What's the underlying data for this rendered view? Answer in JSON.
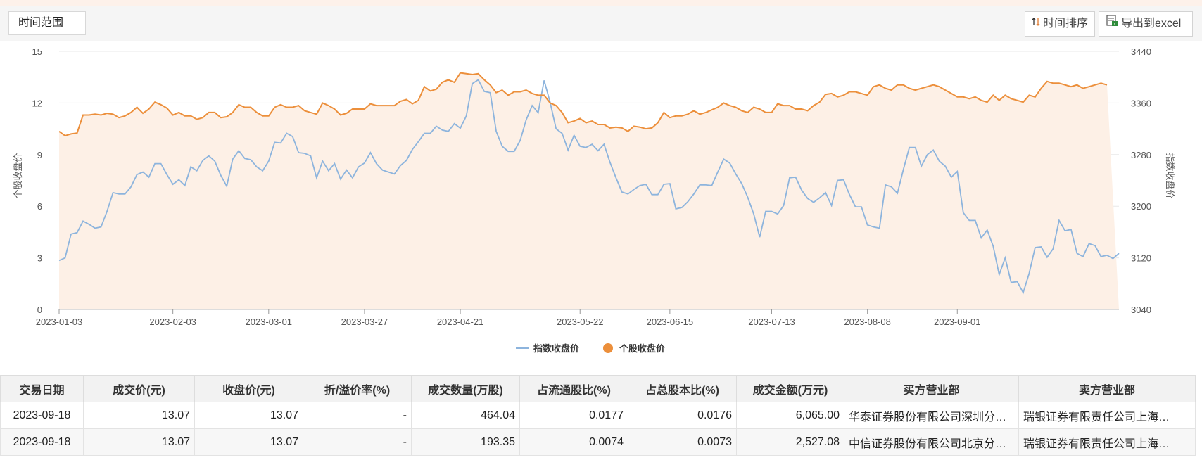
{
  "toolbar": {
    "range_label": "时间范围",
    "sort_label": "时间排序",
    "export_label": "导出到excel"
  },
  "colors": {
    "index_line": "#8db4dd",
    "stock_line": "#ec8f3b",
    "stock_fill": "#fdf0e6"
  },
  "chart_data": {
    "type": "line",
    "x_ticks": [
      "2023-01-03",
      "2023-02-03",
      "2023-03-01",
      "2023-03-27",
      "2023-04-21",
      "2023-05-22",
      "2023-06-15",
      "2023-07-13",
      "2023-08-08",
      "2023-09-01"
    ],
    "y_left": {
      "label": "个股收盘价",
      "min": 0,
      "max": 15,
      "ticks": [
        0,
        3,
        6,
        9,
        12,
        15
      ]
    },
    "y_right": {
      "label": "指数收盘价",
      "min": 3040,
      "max": 3440,
      "ticks": [
        3040,
        3120,
        3200,
        3280,
        3360,
        3440
      ]
    },
    "legend": [
      "指数收盘价",
      "个股收盘价"
    ],
    "series": [
      {
        "name": "指数收盘价",
        "axis": "right",
        "values": [
          3116,
          3120,
          3157,
          3159,
          3177,
          3172,
          3166,
          3168,
          3192,
          3221,
          3219,
          3219,
          3230,
          3249,
          3253,
          3245,
          3266,
          3266,
          3249,
          3234,
          3241,
          3232,
          3261,
          3255,
          3271,
          3278,
          3270,
          3248,
          3231,
          3273,
          3286,
          3274,
          3272,
          3261,
          3255,
          3270,
          3299,
          3298,
          3313,
          3308,
          3283,
          3282,
          3278,
          3244,
          3270,
          3255,
          3266,
          3242,
          3256,
          3244,
          3261,
          3267,
          3283,
          3266,
          3256,
          3253,
          3250,
          3263,
          3271,
          3288,
          3300,
          3313,
          3313,
          3324,
          3318,
          3316,
          3328,
          3321,
          3340,
          3390,
          3396,
          3378,
          3376,
          3316,
          3293,
          3285,
          3285,
          3302,
          3334,
          3356,
          3345,
          3395,
          3361,
          3320,
          3313,
          3287,
          3310,
          3293,
          3291,
          3296,
          3286,
          3296,
          3268,
          3244,
          3222,
          3219,
          3226,
          3232,
          3234,
          3218,
          3218,
          3234,
          3235,
          3196,
          3198,
          3207,
          3219,
          3233,
          3233,
          3232,
          3253,
          3273,
          3267,
          3250,
          3235,
          3214,
          3188,
          3152,
          3192,
          3192,
          3188,
          3201,
          3244,
          3245,
          3225,
          3212,
          3206,
          3213,
          3221,
          3201,
          3240,
          3241,
          3218,
          3199,
          3199,
          3171,
          3168,
          3166,
          3233,
          3230,
          3220,
          3257,
          3291,
          3291,
          3262,
          3280,
          3287,
          3270,
          3262,
          3245,
          3254,
          3190,
          3178,
          3178,
          3151,
          3163,
          3138,
          3094,
          3120,
          3082,
          3083,
          3066,
          3096,
          3136,
          3137,
          3121,
          3134,
          3178,
          3162,
          3164,
          3127,
          3122,
          3142,
          3139,
          3122,
          3124,
          3119,
          3127
        ]
      },
      {
        "name": "个股收盘价",
        "axis": "left",
        "values": [
          10.35,
          10.1,
          10.2,
          10.25,
          11.3,
          11.3,
          11.35,
          11.3,
          11.4,
          11.35,
          11.15,
          11.25,
          11.45,
          11.75,
          11.4,
          11.65,
          12.05,
          11.9,
          11.7,
          11.3,
          11.45,
          11.25,
          11.25,
          11.05,
          11.15,
          11.45,
          11.45,
          11.15,
          11.2,
          11.45,
          11.9,
          11.75,
          11.75,
          11.45,
          11.25,
          11.25,
          11.75,
          11.9,
          11.75,
          11.75,
          11.85,
          11.55,
          11.45,
          11.35,
          12.0,
          11.85,
          11.65,
          11.3,
          11.4,
          11.65,
          11.65,
          11.65,
          11.95,
          11.85,
          11.85,
          11.85,
          11.85,
          12.1,
          12.2,
          11.95,
          12.15,
          12.95,
          12.7,
          12.8,
          13.2,
          13.35,
          13.2,
          13.75,
          13.7,
          13.65,
          13.7,
          13.35,
          13.05,
          12.6,
          12.75,
          12.45,
          12.65,
          12.65,
          12.75,
          12.55,
          12.45,
          12.45,
          12.0,
          11.85,
          11.45,
          10.85,
          10.95,
          11.1,
          10.85,
          10.95,
          10.75,
          10.75,
          10.55,
          10.6,
          10.55,
          10.35,
          10.65,
          10.6,
          10.5,
          10.55,
          10.85,
          11.45,
          11.15,
          11.25,
          11.25,
          11.35,
          11.55,
          11.35,
          11.45,
          11.6,
          11.75,
          12.0,
          11.85,
          11.75,
          11.55,
          11.45,
          11.75,
          11.65,
          11.45,
          11.45,
          11.95,
          11.85,
          11.85,
          11.65,
          11.65,
          11.55,
          11.85,
          12.05,
          12.5,
          12.55,
          12.35,
          12.45,
          12.65,
          12.65,
          12.55,
          12.45,
          12.95,
          13.05,
          12.85,
          12.75,
          13.05,
          13.05,
          12.85,
          12.75,
          12.85,
          12.95,
          13.05,
          12.95,
          12.75,
          12.55,
          12.35,
          12.35,
          12.25,
          12.35,
          12.15,
          12.05,
          12.45,
          12.15,
          12.45,
          12.25,
          12.15,
          12.05,
          12.45,
          12.35,
          12.85,
          13.25,
          13.15,
          13.15,
          13.05,
          12.95,
          13.05,
          12.85,
          12.95,
          13.05,
          13.15,
          13.05
        ]
      }
    ]
  },
  "table": {
    "columns": [
      "交易日期",
      "成交价(元)",
      "收盘价(元)",
      "折/溢价率(%)",
      "成交数量(万股)",
      "占流通股比(%)",
      "占总股本比(%)",
      "成交金额(万元)",
      "买方营业部",
      "卖方营业部"
    ],
    "rows": [
      [
        "2023-09-18",
        "13.07",
        "13.07",
        "-",
        "464.04",
        "0.0177",
        "0.0176",
        "6,065.00",
        "华泰证券股份有限公司深圳分…",
        "瑞银证券有限责任公司上海…"
      ],
      [
        "2023-09-18",
        "13.07",
        "13.07",
        "-",
        "193.35",
        "0.0074",
        "0.0073",
        "2,527.08",
        "中信证券股份有限公司北京分…",
        "瑞银证券有限责任公司上海…"
      ]
    ]
  }
}
